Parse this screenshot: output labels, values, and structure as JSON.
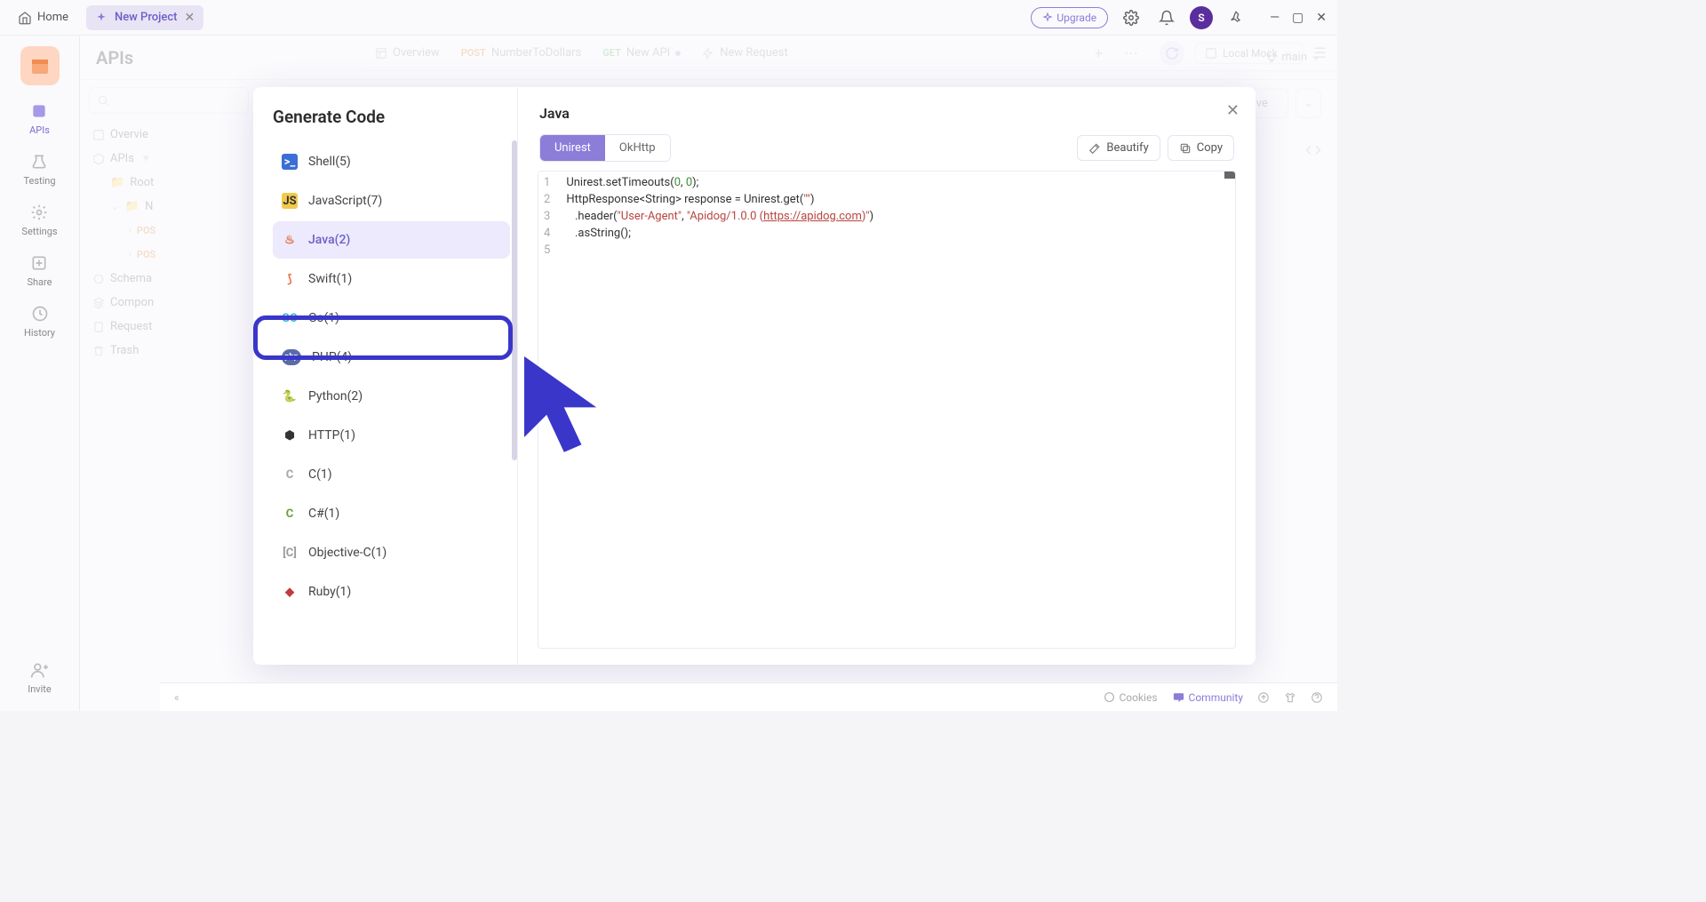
{
  "titlebar": {
    "home": "Home",
    "tab_label": "New Project",
    "upgrade": "Upgrade",
    "avatar_initial": "S"
  },
  "left_rail": {
    "items": [
      {
        "label": "APIs"
      },
      {
        "label": "Testing"
      },
      {
        "label": "Settings"
      },
      {
        "label": "Share"
      },
      {
        "label": "History"
      }
    ],
    "invite": "Invite"
  },
  "page": {
    "title": "APIs",
    "branch": "main"
  },
  "content_tabs": {
    "overview": "Overview",
    "t1_method": "POST",
    "t1_label": "NumberToDollars",
    "t2_method": "GET",
    "t2_label": "New API",
    "t3_label": "New Request",
    "env": "Local Mock"
  },
  "sidebar_tree": {
    "overview": "Overvie",
    "apis": "APIs",
    "root": "Root",
    "n": "N",
    "pos1": "POS",
    "pos2": "POS",
    "schemas": "Schema",
    "components": "Compon",
    "requests": "Request",
    "trash": "Trash"
  },
  "save_area": {
    "save": "Save"
  },
  "modal": {
    "title": "Generate Code",
    "selected_lang": "Java",
    "langs": [
      {
        "label": "Shell(5)",
        "ico": "shell"
      },
      {
        "label": "JavaScript(7)",
        "ico": "js"
      },
      {
        "label": "Java(2)",
        "ico": "java"
      },
      {
        "label": "Swift(1)",
        "ico": "swift"
      },
      {
        "label": "Go(1)",
        "ico": "go"
      },
      {
        "label": "PHP(4)",
        "ico": "php"
      },
      {
        "label": "Python(2)",
        "ico": "py"
      },
      {
        "label": "HTTP(1)",
        "ico": "http"
      },
      {
        "label": "C(1)",
        "ico": "c"
      },
      {
        "label": "C#(1)",
        "ico": "cs"
      },
      {
        "label": "Objective-C(1)",
        "ico": "objc"
      },
      {
        "label": "Ruby(1)",
        "ico": "ruby"
      }
    ],
    "variants": [
      {
        "label": "Unirest",
        "active": true
      },
      {
        "label": "OkHttp",
        "active": false
      }
    ],
    "beautify": "Beautify",
    "copy": "Copy",
    "code_lines": [
      "1",
      "2",
      "3",
      "4",
      "5"
    ]
  },
  "statusbar": {
    "cookies": "Cookies",
    "community": "Community"
  }
}
